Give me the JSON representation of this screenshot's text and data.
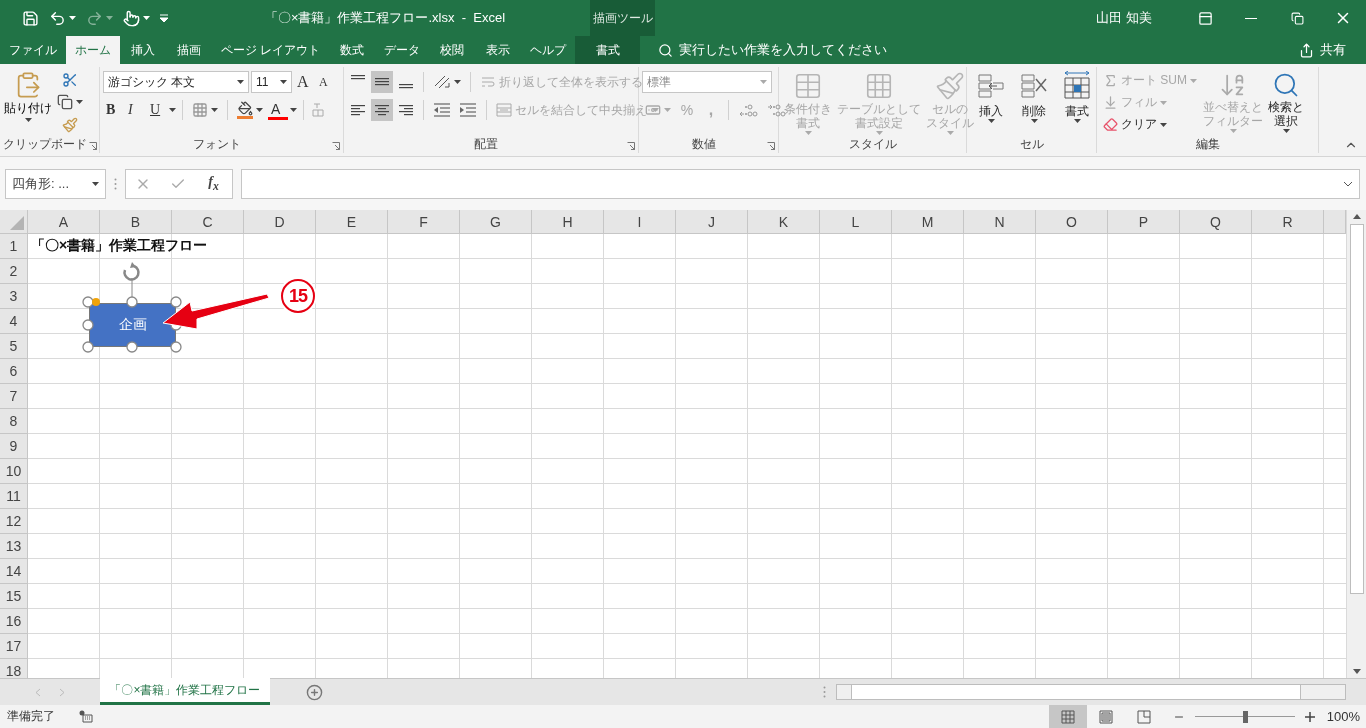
{
  "title_bar": {
    "title": "「〇×書籍」作業工程フロー.xlsx  -  Excel",
    "context_label": "描画ツール",
    "user": "山田 知美"
  },
  "tabs": [
    {
      "label": "ファイル",
      "selected": false,
      "kind": "normal"
    },
    {
      "label": "ホーム",
      "selected": true,
      "kind": "normal"
    },
    {
      "label": "挿入",
      "selected": false,
      "kind": "normal"
    },
    {
      "label": "描画",
      "selected": false,
      "kind": "normal"
    },
    {
      "label": "ページ レイアウト",
      "selected": false,
      "kind": "normal"
    },
    {
      "label": "数式",
      "selected": false,
      "kind": "normal"
    },
    {
      "label": "データ",
      "selected": false,
      "kind": "normal"
    },
    {
      "label": "校閲",
      "selected": false,
      "kind": "normal"
    },
    {
      "label": "表示",
      "selected": false,
      "kind": "normal"
    },
    {
      "label": "ヘルプ",
      "selected": false,
      "kind": "normal"
    },
    {
      "label": "書式",
      "selected": false,
      "kind": "contextual"
    }
  ],
  "tell_me": {
    "label": "実行したい作業を入力してください"
  },
  "share": {
    "label": "共有"
  },
  "ribbon": {
    "groups": [
      {
        "kind": "clipboard",
        "label": "クリップボード",
        "paste": "貼り付け"
      },
      {
        "kind": "font",
        "label": "フォント",
        "font_name": "游ゴシック 本文",
        "font_size": "11",
        "grow": "A",
        "shrink": "A",
        "bold": "B",
        "italic": "I",
        "underline": "U",
        "font_color": "A"
      },
      {
        "kind": "alignment",
        "label": "配置",
        "vertical_align": [
          {
            "selected": false
          },
          {
            "selected": true
          },
          {
            "selected": false
          }
        ],
        "horizontal_align": [
          {
            "selected": false
          },
          {
            "selected": true
          },
          {
            "selected": false
          }
        ],
        "wrap_text": {
          "label": "折り返して全体を表示する",
          "disabled": true
        },
        "merge": {
          "label": "セルを結合して中央揃え",
          "disabled": true
        }
      },
      {
        "kind": "number",
        "label": "数値",
        "format": {
          "label": "標準",
          "disabled": true
        },
        "percent": "%",
        "comma": ","
      },
      {
        "kind": "styles",
        "label": "スタイル",
        "buttons": [
          {
            "lines": [
              "条件付き",
              "書式"
            ],
            "disabled": true
          },
          {
            "lines": [
              "テーブルとして",
              "書式設定"
            ],
            "disabled": true
          },
          {
            "lines": [
              "セルの",
              "スタイル"
            ],
            "disabled": true
          }
        ]
      },
      {
        "kind": "cells",
        "label": "セル",
        "buttons": [
          {
            "lines": [
              "挿入"
            ],
            "disabled": false
          },
          {
            "lines": [
              "削除"
            ],
            "disabled": false
          },
          {
            "lines": [
              "書式"
            ],
            "disabled": false
          }
        ]
      },
      {
        "kind": "editing",
        "label": "編集",
        "small": [
          {
            "label": "オート SUM",
            "disabled": true
          },
          {
            "label": "フィル",
            "disabled": true
          },
          {
            "label": "クリア",
            "disabled": false
          }
        ],
        "buttons": [
          {
            "lines": [
              "並べ替えと",
              "フィルター"
            ],
            "disabled": true
          },
          {
            "lines": [
              "検索と",
              "選択"
            ],
            "disabled": false
          }
        ]
      }
    ]
  },
  "formula_bar": {
    "name_box": "四角形: ...",
    "function_label": "f$_{x}$"
  },
  "sheet": {
    "columns": [
      "A",
      "B",
      "C",
      "D",
      "E",
      "F",
      "G",
      "H",
      "I",
      "J",
      "K",
      "L",
      "M",
      "N",
      "O",
      "P",
      "Q",
      "R"
    ],
    "rows": [
      {
        "label": "1",
        "cells": [
          "「〇×書籍」作業工程フロー"
        ]
      },
      {
        "label": "2"
      },
      {
        "label": "3"
      },
      {
        "label": "4"
      },
      {
        "label": "5"
      },
      {
        "label": "6"
      },
      {
        "label": "7"
      },
      {
        "label": "8"
      },
      {
        "label": "9"
      },
      {
        "label": "10"
      },
      {
        "label": "11"
      },
      {
        "label": "12"
      },
      {
        "label": "13"
      },
      {
        "label": "14"
      },
      {
        "label": "15"
      },
      {
        "label": "16"
      },
      {
        "label": "17"
      },
      {
        "label": "18"
      }
    ],
    "shape": {
      "text": "企画",
      "selected": true
    },
    "callout": {
      "number": "15"
    }
  },
  "sheet_tabs": [
    {
      "label": "「〇×書籍」作業工程フロー",
      "selected": true
    }
  ],
  "status_bar": {
    "status": "準備完了",
    "views": [
      {
        "kind": "normal",
        "selected": true
      },
      {
        "kind": "page_layout",
        "selected": false
      },
      {
        "kind": "page_break",
        "selected": false
      }
    ],
    "zoom": {
      "level": 0.5,
      "reading": "100%"
    }
  }
}
